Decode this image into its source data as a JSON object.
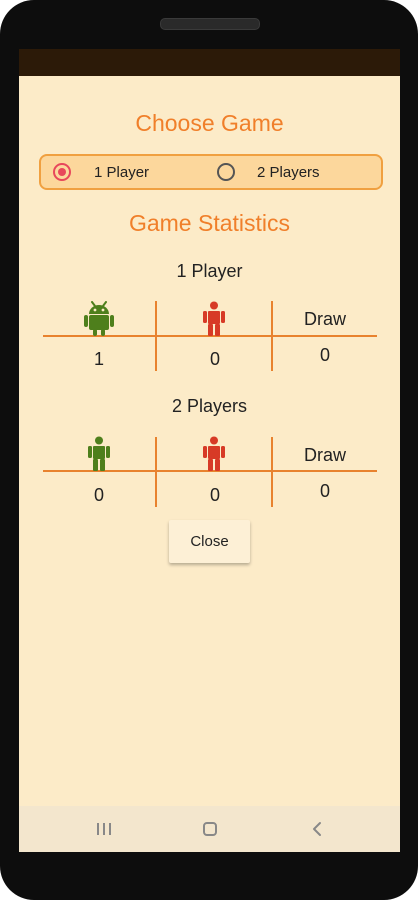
{
  "colors": {
    "accent": "#f07f2a",
    "background": "#fcebc8",
    "selected_radio": "#e8475b",
    "android_green": "#4e7f1c",
    "human_red": "#d73a26",
    "divider": "#e8822e"
  },
  "choose_game": {
    "title": "Choose Game",
    "options": [
      {
        "label": "1 Player",
        "selected": true
      },
      {
        "label": "2 Players",
        "selected": false
      }
    ]
  },
  "statistics": {
    "title": "Game Statistics",
    "sections": [
      {
        "label": "1 Player",
        "columns": [
          {
            "icon": "android-icon",
            "value": "1"
          },
          {
            "icon": "human-icon",
            "value": "0"
          },
          {
            "header": "Draw",
            "value": "0"
          }
        ]
      },
      {
        "label": "2 Players",
        "columns": [
          {
            "icon": "green-human-icon",
            "value": "0"
          },
          {
            "icon": "human-icon",
            "value": "0"
          },
          {
            "header": "Draw",
            "value": "0"
          }
        ]
      }
    ]
  },
  "close_button": {
    "label": "Close"
  },
  "nav": {
    "icons": [
      "recent-apps-icon",
      "home-icon",
      "back-icon"
    ]
  }
}
